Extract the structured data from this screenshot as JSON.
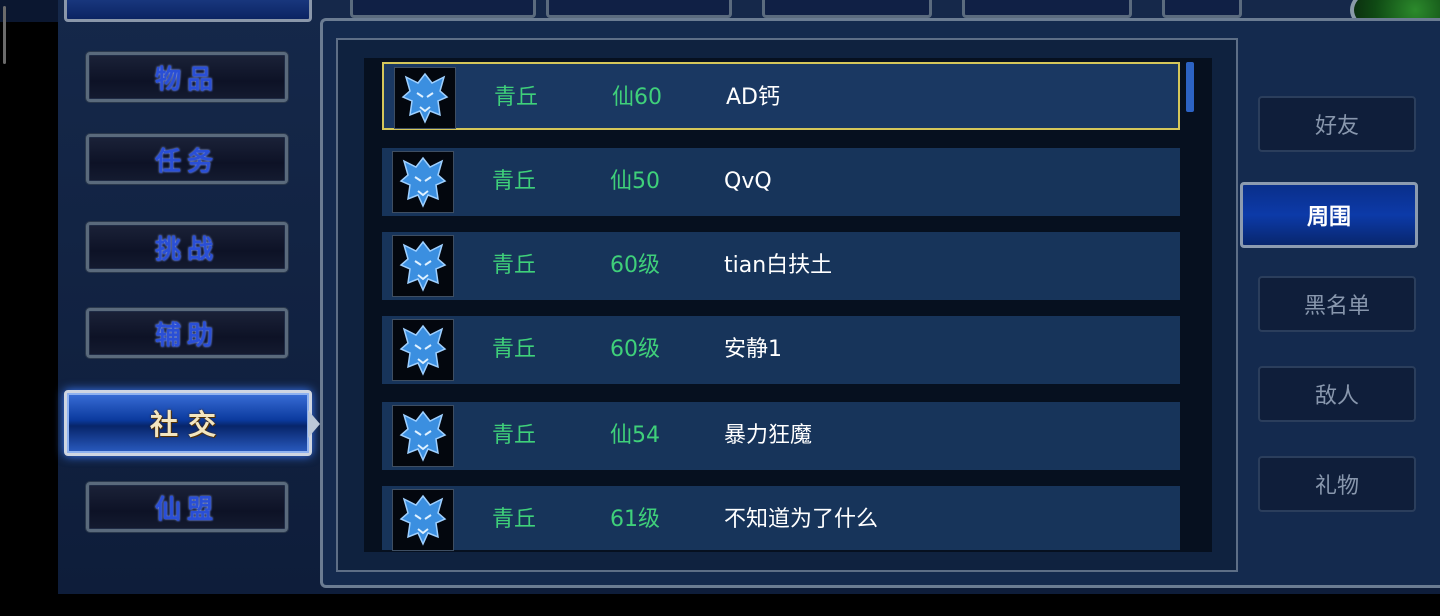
{
  "left_menu": [
    {
      "label": "物品",
      "active": false
    },
    {
      "label": "任务",
      "active": false
    },
    {
      "label": "挑战",
      "active": false
    },
    {
      "label": "辅助",
      "active": false
    },
    {
      "label": "社交",
      "active": true
    },
    {
      "label": "仙盟",
      "active": false
    }
  ],
  "right_menu": [
    {
      "label": "好友",
      "active": false
    },
    {
      "label": "周围",
      "active": true
    },
    {
      "label": "黑名单",
      "active": false
    },
    {
      "label": "敌人",
      "active": false
    },
    {
      "label": "礼物",
      "active": false
    }
  ],
  "players": [
    {
      "school": "青丘",
      "level": "仙60",
      "name": "AD钙",
      "selected": true,
      "icon": "fox-emblem-icon"
    },
    {
      "school": "青丘",
      "level": "仙50",
      "name": "QvQ",
      "selected": false,
      "icon": "fox-emblem-icon"
    },
    {
      "school": "青丘",
      "level": "60级",
      "name": "tian白扶土",
      "selected": false,
      "icon": "fox-emblem-icon"
    },
    {
      "school": "青丘",
      "level": "60级",
      "name": "安静1",
      "selected": false,
      "icon": "fox-emblem-icon"
    },
    {
      "school": "青丘",
      "level": "仙54",
      "name": "暴力狂魔",
      "selected": false,
      "icon": "fox-emblem-icon"
    },
    {
      "school": "青丘",
      "level": "61级",
      "name": "不知道为了什么",
      "selected": false,
      "icon": "fox-emblem-icon"
    }
  ],
  "colors": {
    "accent_green": "#3fd07a",
    "selection_border": "#d4c65a",
    "active_blue": "#0c3aa8"
  }
}
